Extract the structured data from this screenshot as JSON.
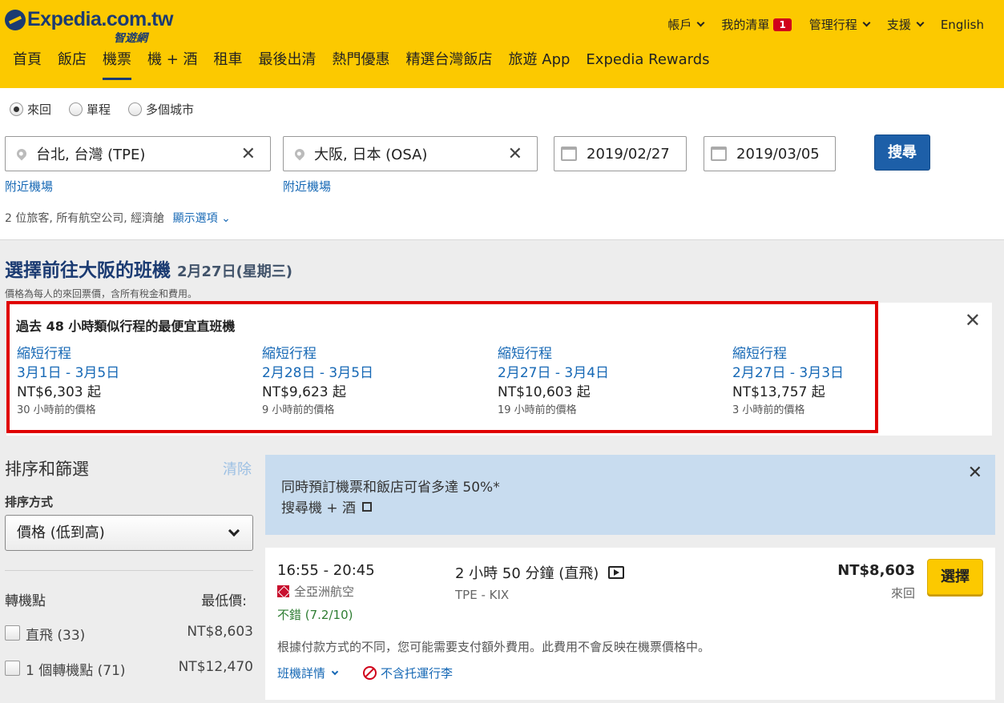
{
  "header": {
    "logo_text": "Expedia.com.tw",
    "logo_sub": "智遊網",
    "top_nav": [
      {
        "label": "帳戶"
      },
      {
        "label": "我的清單",
        "badge": "1"
      },
      {
        "label": "管理行程"
      },
      {
        "label": "支援"
      },
      {
        "label": "English"
      }
    ],
    "main_nav": [
      "首頁",
      "飯店",
      "機票",
      "機 + 酒",
      "租車",
      "最後出清",
      "熱門優惠",
      "精選台灣飯店",
      "旅遊 App",
      "Expedia Rewards"
    ]
  },
  "search": {
    "trip_types": [
      "來回",
      "單程",
      "多個城市"
    ],
    "origin": "台北, 台灣 (TPE)",
    "destination": "大阪, 日本 (OSA)",
    "depart_date": "2019/02/27",
    "return_date": "2019/03/05",
    "nearby_airports": "附近機場",
    "search_button": "搜尋",
    "travelers_summary": "2 位旅客, 所有航空公司, 經濟艙",
    "show_options": "顯示選項"
  },
  "results": {
    "title": "選擇前往大阪的班機",
    "date": "2月27日(星期三)",
    "price_note": "價格為每人的來回票價，含所有稅金和費用。"
  },
  "deals": {
    "title": "過去 48 小時類似行程的最便宜直班機",
    "items": [
      {
        "label": "縮短行程",
        "dates": "3月1日 - 3月5日",
        "price": "NT$6,303 起",
        "ago": "30 小時前的價格"
      },
      {
        "label": "縮短行程",
        "dates": "2月28日 - 3月5日",
        "price": "NT$9,623 起",
        "ago": "9 小時前的價格"
      },
      {
        "label": "縮短行程",
        "dates": "2月27日 - 3月4日",
        "price": "NT$10,603 起",
        "ago": "19 小時前的價格"
      },
      {
        "label": "縮短行程",
        "dates": "2月27日 - 3月3日",
        "price": "NT$13,757 起",
        "ago": "3 小時前的價格"
      }
    ]
  },
  "sidebar": {
    "title": "排序和篩選",
    "clear": "清除",
    "sort_label": "排序方式",
    "sort_value": "價格 (低到高)",
    "stops_label": "轉機點",
    "lowest_price_label": "最低價:",
    "stops": [
      {
        "label": "直飛 (33)",
        "price": "NT$8,603"
      },
      {
        "label": "1 個轉機點 (71)",
        "price": "NT$12,470"
      }
    ]
  },
  "promo": {
    "line1": "同時預訂機票和飯店可省多達 50%*",
    "line2": "搜尋機 + 酒"
  },
  "flight": {
    "times": "16:55 - 20:45",
    "airline": "全亞洲航空",
    "rating": "不錯 (7.2/10)",
    "duration": "2 小時 50 分鐘 (直飛)",
    "route": "TPE - KIX",
    "price": "NT$8,603",
    "trip_type": "來回",
    "select_button": "選擇",
    "fee_note": "根據付款方式的不同，您可能需要支付額外費用。此費用不會反映在機票價格中。",
    "details_link": "班機詳情",
    "baggage_note": "不含托運行李"
  }
}
